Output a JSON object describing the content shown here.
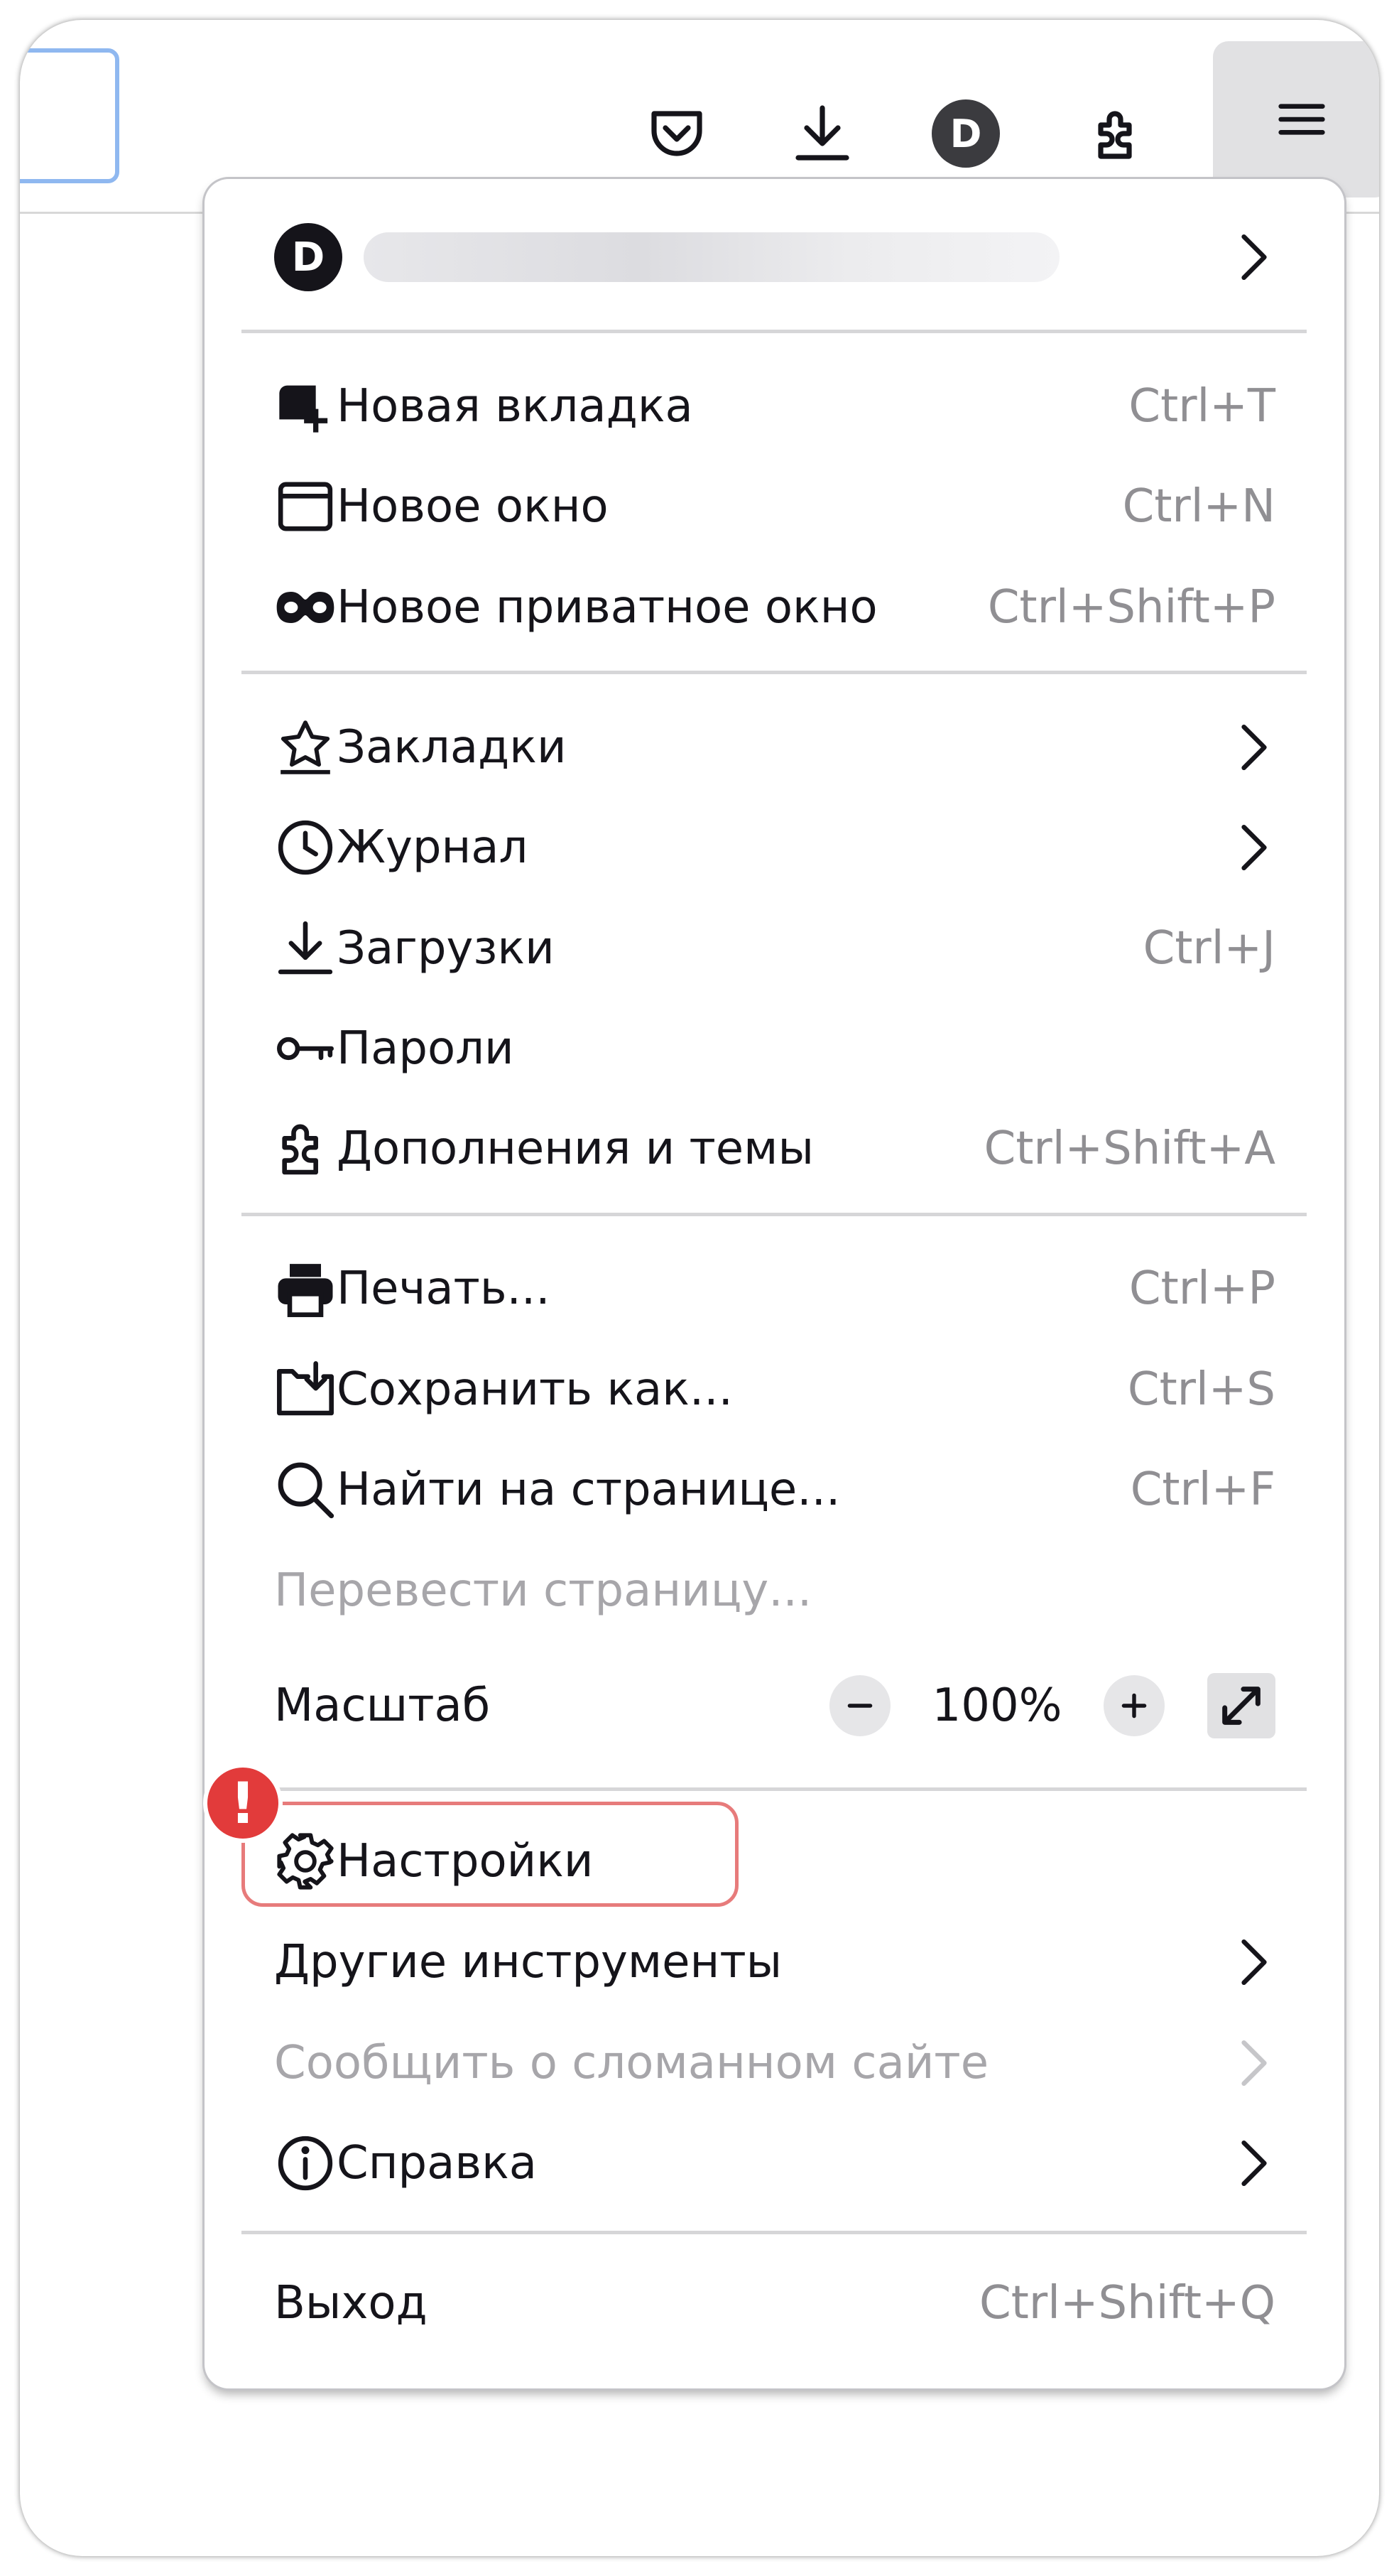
{
  "toolbar": {
    "account_initial": "D",
    "icons": [
      "pocket-icon",
      "download-icon",
      "account-icon",
      "extensions-icon",
      "hamburger-menu-icon"
    ]
  },
  "menu": {
    "account": {
      "initial": "D"
    },
    "items": [
      {
        "name": "new-tab",
        "icon": "new-tab-icon",
        "label": "Новая вкладка",
        "shortcut": "Ctrl+T"
      },
      {
        "name": "new-window",
        "icon": "new-window-icon",
        "label": "Новое окно",
        "shortcut": "Ctrl+N"
      },
      {
        "name": "new-private-window",
        "icon": "private-mask-icon",
        "label": "Новое приватное окно",
        "shortcut": "Ctrl+Shift+P"
      },
      {
        "name": "bookmarks",
        "icon": "bookmark-star-icon",
        "label": "Закладки"
      },
      {
        "name": "history",
        "icon": "clock-icon",
        "label": "Журнал"
      },
      {
        "name": "downloads",
        "icon": "download-icon",
        "label": "Загрузки",
        "shortcut": "Ctrl+J"
      },
      {
        "name": "passwords",
        "icon": "key-icon",
        "label": "Пароли"
      },
      {
        "name": "addons",
        "icon": "puzzle-icon",
        "label": "Дополнения и темы",
        "shortcut": "Ctrl+Shift+A"
      },
      {
        "name": "print",
        "icon": "printer-icon",
        "label": "Печать...",
        "shortcut": "Ctrl+P"
      },
      {
        "name": "save-as",
        "icon": "save-folder-icon",
        "label": "Сохранить как...",
        "shortcut": "Ctrl+S"
      },
      {
        "name": "find",
        "icon": "magnifier-icon",
        "label": "Найти на странице...",
        "shortcut": "Ctrl+F"
      },
      {
        "name": "translate",
        "label": "Перевести страницу...",
        "disabled": true
      },
      {
        "name": "zoom",
        "label": "Масштаб",
        "value": "100%"
      },
      {
        "name": "settings",
        "icon": "gear-icon",
        "label": "Настройки"
      },
      {
        "name": "more-tools",
        "label": "Другие инструменты"
      },
      {
        "name": "report-site",
        "label": "Сообщить о сломанном сайте",
        "disabled": true
      },
      {
        "name": "help",
        "icon": "info-icon",
        "label": "Справка"
      },
      {
        "name": "quit",
        "label": "Выход",
        "shortcut": "Ctrl+Shift+Q"
      }
    ]
  },
  "annotation": {
    "badge": "!"
  },
  "colors": {
    "highlight": "#e77b7b",
    "badge": "#e23b3b",
    "text": "#15141a",
    "muted": "#908f93"
  }
}
